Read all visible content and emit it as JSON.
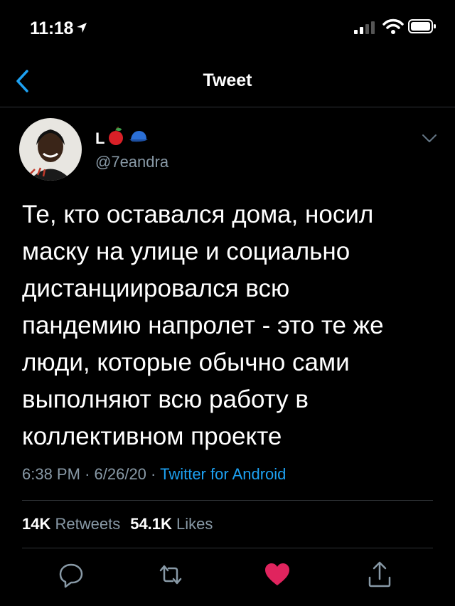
{
  "status_bar": {
    "time": "11:18",
    "icons": [
      "location-arrow-icon",
      "signal-icon",
      "wifi-icon",
      "battery-icon"
    ]
  },
  "nav": {
    "title": "Tweet",
    "back_icon": "chevron-left-icon"
  },
  "tweet": {
    "display_name": "L",
    "name_emojis": [
      "apple-emoji",
      "cap-emoji"
    ],
    "handle": "@7eandra",
    "text": "Те, кто оставался дома, носил\nмаску на улице и социально\nдистанциировался всю\nпандемию напролет - это те же\nлюди, которые обычно сами\nвыполняют всю работу в\nколлективном проекте",
    "time": "6:38 PM",
    "date": "6/26/20",
    "separator": "·",
    "source": "Twitter for Android",
    "retweets_count": "14K",
    "retweets_label": "Retweets",
    "likes_count": "54.1K",
    "likes_label": "Likes"
  },
  "actions": [
    "reply-icon",
    "retweet-icon",
    "like-icon",
    "share-icon"
  ],
  "colors": {
    "background": "#000000",
    "text": "#ffffff",
    "secondary_text": "#8899a6",
    "link": "#1da1f2",
    "like": "#e0245e",
    "divider": "#2f3336"
  }
}
